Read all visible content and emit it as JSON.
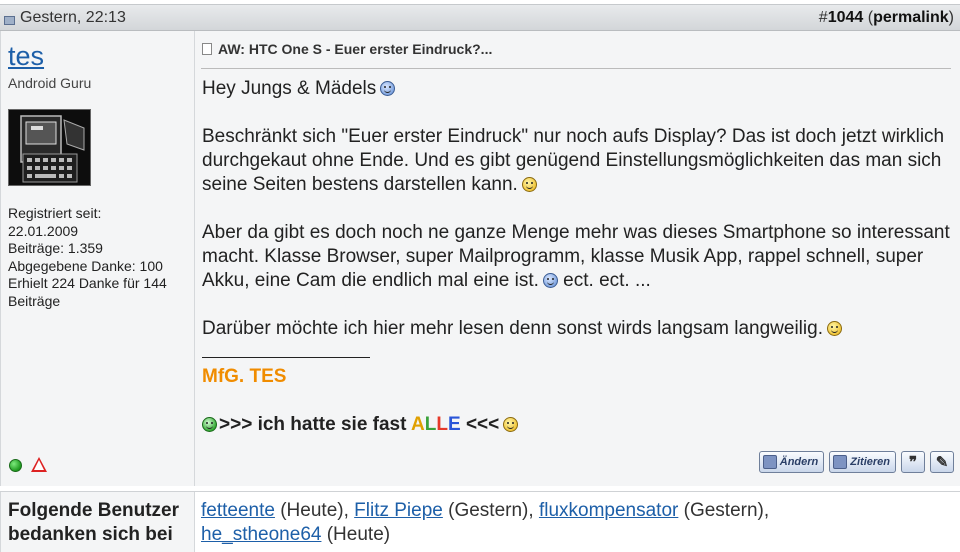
{
  "post": {
    "date": "Gestern, 22:13",
    "number_prefix": "#",
    "number": "1044",
    "permalink": "permalink"
  },
  "user": {
    "name": "tes",
    "title": "Android Guru",
    "registered_label": "Registriert seit:",
    "registered_date": "22.01.2009",
    "posts": "Beiträge: 1.359",
    "thanks_given": "Abgegebene Danke: 100",
    "thanks_received": "Erhielt 224 Danke für 144 Beiträge"
  },
  "message": {
    "title": "AW: HTC One S - Euer erster Eindruck?...",
    "greeting": "Hey Jungs & Mädels",
    "para1": "Beschränkt sich \"Euer erster Eindruck\" nur noch aufs Display? Das ist doch jetzt wirklich durchgekaut ohne Ende. Und es gibt genügend Einstellungsmöglichkeiten das man sich seine Seiten bestens darstellen kann.",
    "para2": "Aber da gibt es doch noch ne ganze Menge mehr was dieses Smartphone so interessant macht. Klasse Browser, super Mailprogramm, klasse Musik App, rappel schnell, super Akku, eine Cam die endlich mal eine ist.",
    "para2_tail": "ect. ect. ...",
    "para3": "Darüber möchte ich hier mehr lesen denn sonst wirds langsam langweilig.",
    "signature": "MfG. TES",
    "motto_pre": ">>> ich hatte sie fast",
    "motto_a": "A",
    "motto_l1": "L",
    "motto_l2": "L",
    "motto_e": "E",
    "motto_post": " <<<"
  },
  "buttons": {
    "edit": "Ändern",
    "quote": "Zitieren",
    "multiquote": "❞",
    "quickreply": "✎"
  },
  "thanks": {
    "label": "Folgende Benutzer bedanken sich bei",
    "users": [
      {
        "name": "fetteente",
        "when": " (Heute), "
      },
      {
        "name": "Flitz Piepe",
        "when": " (Gestern), "
      },
      {
        "name": "fluxkompensator",
        "when": " (Gestern),"
      },
      {
        "name": "he_stheone64",
        "when": " (Heute)"
      }
    ]
  },
  "icons": {
    "post_icon": "post-status-icon",
    "online": "online-status-icon",
    "report": "report-warning-icon"
  }
}
